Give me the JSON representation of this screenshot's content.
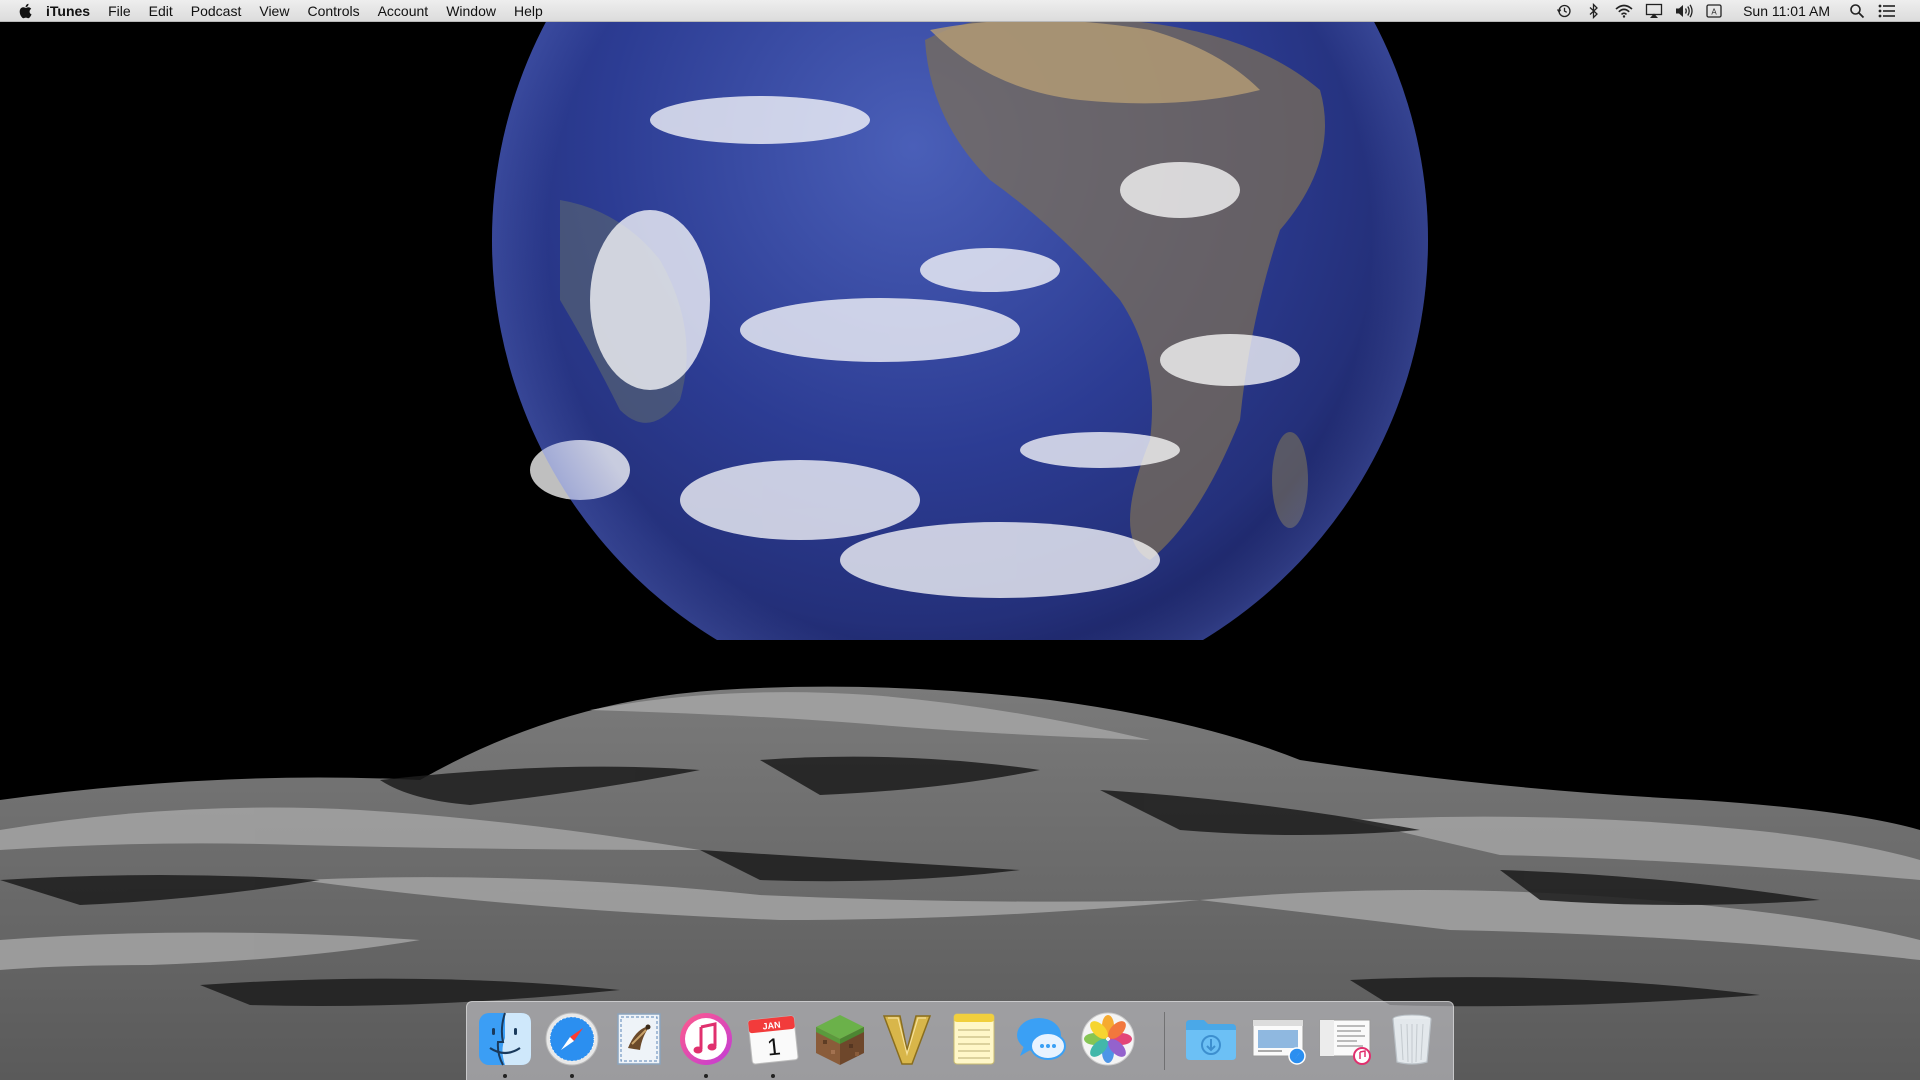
{
  "menubar": {
    "app_name": "iTunes",
    "menus": [
      "File",
      "Edit",
      "Podcast",
      "View",
      "Controls",
      "Account",
      "Window",
      "Help"
    ],
    "clock": "Sun 11:01 AM",
    "status_icons": [
      "time-machine-icon",
      "bluetooth-icon",
      "wifi-icon",
      "airplay-icon",
      "volume-icon",
      "input-source-icon",
      "spotlight-icon",
      "notification-center-icon"
    ]
  },
  "dock": {
    "apps": [
      {
        "icon": "finder-icon",
        "running": true
      },
      {
        "icon": "safari-icon",
        "running": true
      },
      {
        "icon": "mail-icon",
        "running": false
      },
      {
        "icon": "itunes-icon",
        "running": true
      },
      {
        "icon": "calendar-icon",
        "running": true,
        "month": "JAN",
        "day": "1"
      },
      {
        "icon": "minecraft-icon",
        "running": false
      },
      {
        "icon": "vim-icon",
        "running": false
      },
      {
        "icon": "notes-icon",
        "running": false
      },
      {
        "icon": "messages-icon",
        "running": false
      },
      {
        "icon": "photos-icon",
        "running": false
      }
    ],
    "others": [
      {
        "icon": "downloads-folder-icon"
      },
      {
        "icon": "safari-document-icon"
      },
      {
        "icon": "itunes-document-icon"
      },
      {
        "icon": "trash-icon"
      }
    ]
  },
  "colors": {
    "menubar_bg": "#e6e6e6",
    "dock_bg": "#d2d2d7",
    "earth_ocean": "#2a3d8f",
    "moon_surface": "#8c8c8c"
  }
}
